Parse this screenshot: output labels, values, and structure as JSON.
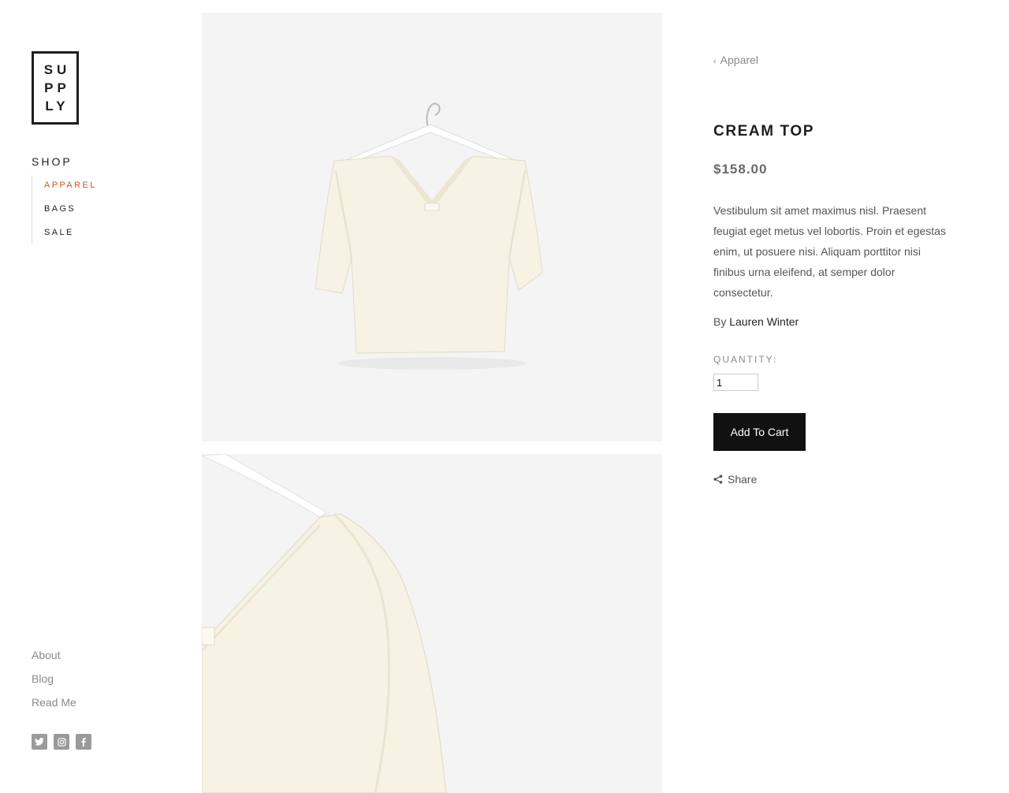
{
  "logo": {
    "lines": [
      "SU",
      "PP",
      "LY"
    ]
  },
  "sidebar": {
    "shop_title": "SHOP",
    "items": [
      {
        "label": "APPAREL",
        "active": true
      },
      {
        "label": "BAGS",
        "active": false
      },
      {
        "label": "SALE",
        "active": false
      }
    ],
    "footer_links": [
      "About",
      "Blog",
      "Read Me"
    ],
    "social_icons": [
      "twitter-icon",
      "instagram-icon",
      "facebook-icon"
    ]
  },
  "product": {
    "breadcrumb": "Apparel",
    "title": "CREAM TOP",
    "price": "$158.00",
    "description": "Vestibulum sit amet maximus nisl. Praesent feugiat eget metus vel lobortis. Proin et egestas enim, ut posuere nisi. Aliquam porttitor nisi finibus urna eleifend, at semper dolor consectetur.",
    "by_prefix": "By",
    "author": "Lauren Winter",
    "quantity_label": "QUANTITY:",
    "quantity_value": "1",
    "add_to_cart_label": "Add To Cart",
    "share_label": "Share"
  },
  "colors": {
    "accent_active": "#c85a28",
    "button_bg": "#111111",
    "muted_text": "#8a8a8a",
    "photo_bg": "#f4f4f4",
    "garment": "#f6f2e4"
  }
}
